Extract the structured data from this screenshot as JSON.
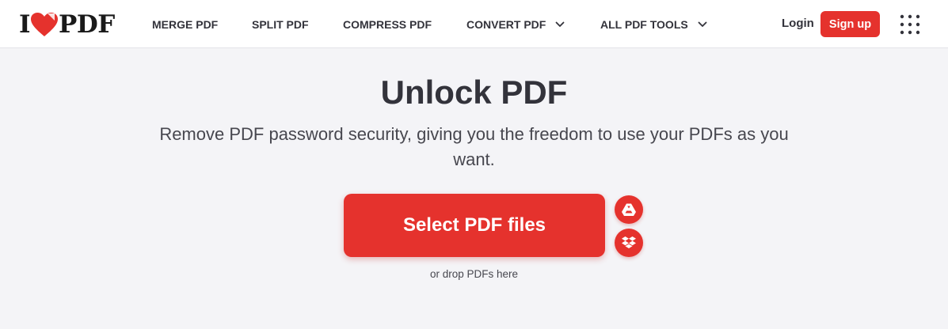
{
  "header": {
    "logo": {
      "left": "I",
      "right": "PDF"
    },
    "nav": [
      {
        "label": "MERGE PDF"
      },
      {
        "label": "SPLIT PDF"
      },
      {
        "label": "COMPRESS PDF"
      },
      {
        "label": "CONVERT PDF",
        "has_dropdown": true
      },
      {
        "label": "ALL PDF TOOLS",
        "has_dropdown": true
      }
    ],
    "login_label": "Login",
    "signup_label": "Sign up"
  },
  "main": {
    "title": "Unlock PDF",
    "subtitle": "Remove PDF password security, giving you the freedom to use your PDFs as you want.",
    "select_label": "Select PDF files",
    "drop_hint": "or drop PDFs here",
    "cloud_sources": [
      "google-drive-icon",
      "dropbox-icon"
    ]
  },
  "colors": {
    "accent": "#e5322d",
    "text": "#33333b",
    "background": "#f4f4f7"
  }
}
